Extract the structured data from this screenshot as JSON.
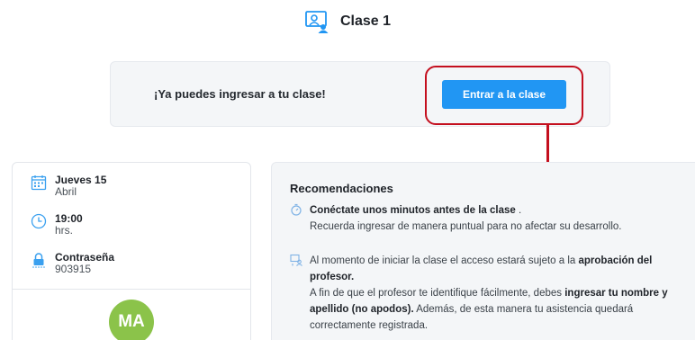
{
  "header": {
    "title": "Clase 1",
    "icon": "teacher-board-icon"
  },
  "banner": {
    "message": "¡Ya puedes ingresar a tu clase!",
    "button_label": "Entrar a la clase"
  },
  "info": {
    "date": {
      "day": "Jueves 15",
      "month": "Abril",
      "icon": "calendar-icon"
    },
    "time": {
      "hour": "19:00",
      "unit": "hrs.",
      "icon": "clock-icon"
    },
    "password": {
      "label": "Contraseña",
      "value": "903915",
      "icon": "lock-icon"
    },
    "avatar_initials": "MA"
  },
  "recommendations": {
    "title": "Recomendaciones",
    "item1": {
      "icon": "stopwatch-icon",
      "bold": "Conéctate unos minutos antes de la clase",
      "after_bold": " .",
      "line2": "Recuerda ingresar de manera puntual para no afectar su desarrollo."
    },
    "item2": {
      "icon": "user-approval-icon",
      "p1": "Al momento de iniciar la clase el acceso estará sujeto a la ",
      "p1_bold": "aprobación del profesor.",
      "p2": "A fin de que el profesor te identifique fácilmente, debes ",
      "p2_bold": "ingresar tu nombre y apellido (no apodos).",
      "p3": " Además, de esta manera tu asistencia quedará correctamente registrada."
    }
  },
  "colors": {
    "primary": "#2196f3",
    "highlight": "#c40f1e",
    "avatar": "#8bc34a",
    "card_bg": "#f4f6f8"
  }
}
